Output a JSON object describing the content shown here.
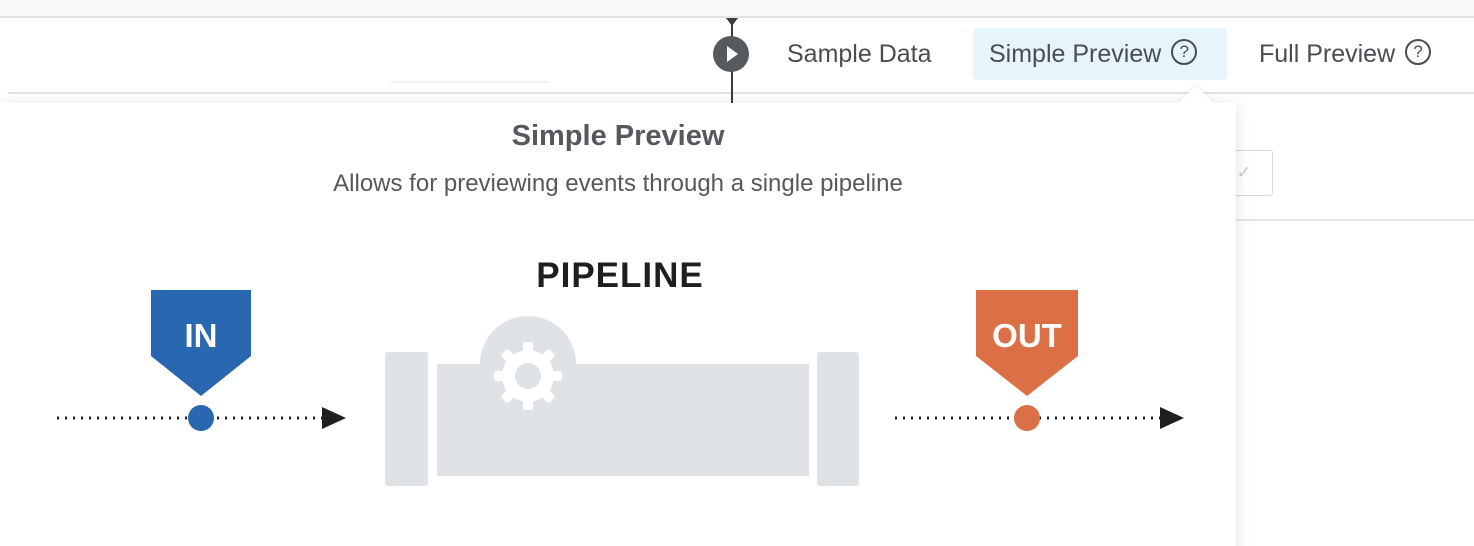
{
  "toolbar": {
    "tabs": [
      {
        "label": "Sample Data",
        "has_help": false,
        "active": false
      },
      {
        "label": "Simple Preview",
        "has_help": true,
        "active": true
      },
      {
        "label": "Full Preview",
        "has_help": true,
        "active": false
      }
    ],
    "help_glyph": "?",
    "check_glyph": "✓"
  },
  "popover": {
    "title": "Simple Preview",
    "subtitle": "Allows for previewing events through a single pipeline",
    "pipeline_label": "PIPELINE",
    "in_label": "IN",
    "out_label": "OUT"
  },
  "colors": {
    "in": "#2a67b1",
    "out": "#db7047",
    "pipe": "#dfe3e7",
    "active_tab_bg": "#e6f5fc",
    "text": "#4a4d51"
  },
  "icons": [
    "play-icon",
    "help-icon",
    "gear-icon",
    "checkmark-icon"
  ]
}
